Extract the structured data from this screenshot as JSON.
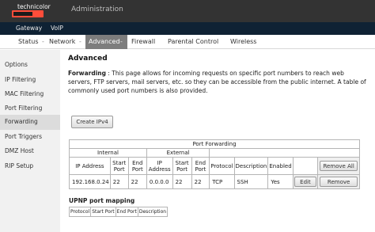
{
  "header": {
    "logo_text": "technicolor",
    "title": "Administration"
  },
  "top_tabs": [
    "Gateway",
    "VoIP"
  ],
  "menu": [
    "Status",
    "Network",
    "Advanced",
    "Firewall",
    "Parental Control",
    "Wireless"
  ],
  "menu_separators": [
    "-",
    "-",
    "-"
  ],
  "sidebar": [
    "Options",
    "IP Filtering",
    "MAC Filtering",
    "Port Filtering",
    "Forwarding",
    "Port Triggers",
    "DMZ Host",
    "RIP Setup"
  ],
  "main": {
    "heading": "Advanced",
    "desc_label": "Forwarding",
    "desc_text": " : This page allows for incoming requests on specific port numbers to reach web servers, FTP servers, mail servers, etc. so they can be accessible from the public internet. A table of commonly used port numbers is also provided.",
    "create_button": "Create IPv4"
  },
  "pf_table": {
    "title": "Port Forwarding",
    "internal": "Internal",
    "external": "External",
    "headers": {
      "ip_address": "IP Address",
      "start_port": "Start Port",
      "end_port": "End Port",
      "protocol": "Protocol",
      "description": "Description",
      "enabled": "Enabled"
    },
    "remove_all": "Remove All",
    "row": {
      "int_ip": "192.168.0.24",
      "int_start": "22",
      "int_end": "22",
      "ext_ip": "0.0.0.0",
      "ext_start": "22",
      "ext_end": "22",
      "protocol": "TCP",
      "description": "SSH",
      "enabled": "Yes",
      "edit": "Edit",
      "remove": "Remove"
    }
  },
  "upnp": {
    "title": "UPNP port mapping",
    "headers": [
      "Protocol",
      "Start Port",
      "End Port",
      "Description"
    ]
  }
}
